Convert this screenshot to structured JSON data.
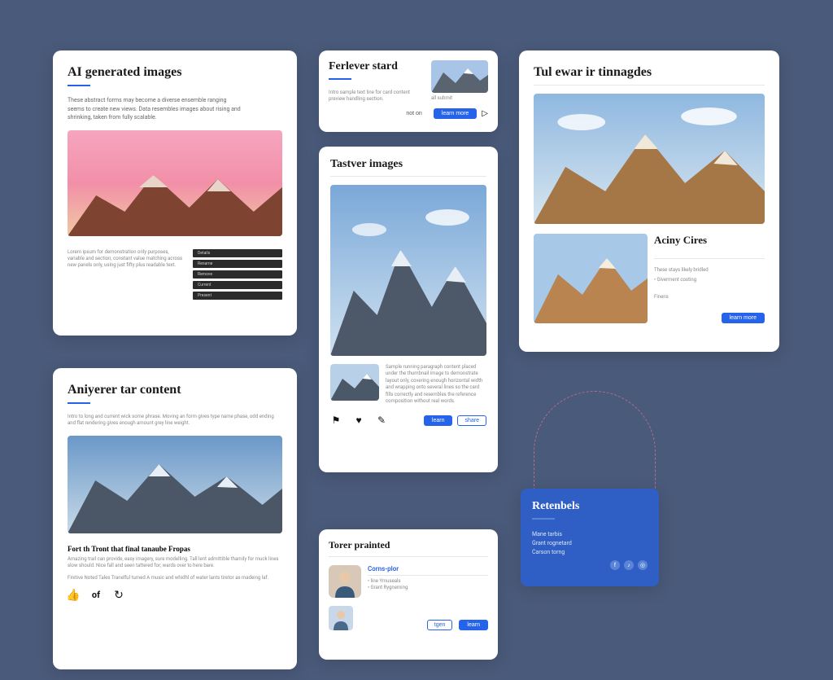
{
  "card1": {
    "title": "AI generated images",
    "subtitle_line1": "These abstract forms may become a diverse ensemble ranging",
    "subtitle_line2": "seems to create new views. Data resembles images about rising and",
    "subtitle_line3": "shrinking, taken from fully scalable.",
    "body": "Lorem ipsum for demonstration only purposes, variable and section, constant value matching across new panels only, using just fifty plus readable text.",
    "menu": [
      "Details",
      "Rename",
      "Remove",
      "Current",
      "Present"
    ]
  },
  "card2": {
    "title": "Ferlever stard",
    "body": "Intro sample text line for card content preview handling section.",
    "caption": "all  submit",
    "actions": {
      "ghost": "not on",
      "primary": "learn more",
      "icon": "▷"
    }
  },
  "card3": {
    "title": "Tastver images",
    "body": "Sample running paragraph content placed under the thumbnail image to demonstrate layout only, covering enough horizontal width and wrapping onto several lines so the card fills correctly and resembles the reference composition without real words.",
    "actions": {
      "primary": "learn",
      "secondary": "share"
    },
    "icons": [
      "flag-icon",
      "heart-icon",
      "tag-icon"
    ]
  },
  "card4": {
    "title": "Tul ewar ir tinnagdes",
    "aside": {
      "title": "Aciny Cires",
      "line1": "These stays likely bridled",
      "bullet1": "• Giverment costing",
      "label": "Finens",
      "button": "learn more"
    }
  },
  "card5": {
    "title": "Aniyerer tar content",
    "subtitle": "Intro to long and current wick some phrase. Moving an form gives type name phase, odd ending and flat rendering gives enough amount grey line weight.",
    "heading": "Fort th Tront that final tanaube Fropas",
    "body1": "Amazing trail can provide, easy imagery, sure modelling. Tall lent admittible thamily for muck lines slow should. Nice fall and seen tattered for; wards over to here bare.",
    "body2": "Finitive Noted  Tales Tranelful turned A music and whidhl of water lants tiretor as madeing laf.",
    "icons": [
      "thumbs-icon",
      "of-icon",
      "link-icon"
    ]
  },
  "card6": {
    "title": "Torer prainted",
    "name": "Corns-plor",
    "bullets": [
      "• line Ymuseals",
      "• Grant Rygneming"
    ],
    "actions": {
      "outline": "tgen",
      "primary": "learn"
    }
  },
  "card7": {
    "title": "Retenbels",
    "items": [
      "Mane tarbis",
      "Grant rognetard",
      "Carson torng"
    ]
  }
}
